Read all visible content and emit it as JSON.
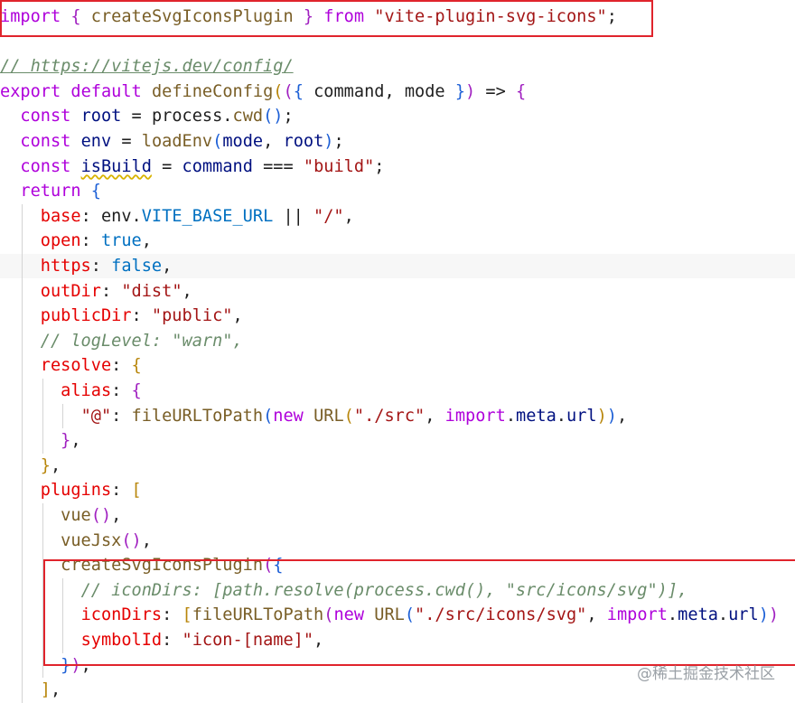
{
  "colors": {
    "background": "#ffffff",
    "keyword": "#af00db",
    "function": "#795e26",
    "variable": "#001080",
    "constant": "#0070c1",
    "string": "#a31515",
    "comment": "#6a8c6a",
    "punctuation": "#1f1f1f",
    "bracket_yellow": "#b8860b",
    "bracket_purple": "#a020c0",
    "bracket_blue": "#1c5fd6",
    "property": "#e50000",
    "annotation_box": "#e0242c"
  },
  "code": {
    "lines": [
      [
        [
          "import",
          "keyword"
        ],
        [
          " ",
          ""
        ],
        [
          "{",
          "bracket_purple"
        ],
        [
          " ",
          ""
        ],
        [
          "createSvgIconsPlugin",
          "function"
        ],
        [
          " ",
          ""
        ],
        [
          "}",
          "bracket_purple"
        ],
        [
          " ",
          ""
        ],
        [
          "from",
          "keyword"
        ],
        [
          " ",
          ""
        ],
        [
          "\"vite-plugin-svg-icons\"",
          "string"
        ],
        [
          ";",
          "punctuation"
        ]
      ],
      [],
      [
        [
          "// https://vitejs.dev/config/",
          "comment"
        ]
      ],
      [
        [
          "export",
          "keyword"
        ],
        [
          " ",
          ""
        ],
        [
          "default",
          "keyword"
        ],
        [
          " ",
          ""
        ],
        [
          "defineConfig",
          "function"
        ],
        [
          "(",
          "bracket_yellow"
        ],
        [
          "(",
          "bracket_purple"
        ],
        [
          "{",
          "bracket_blue"
        ],
        [
          " command, mode ",
          "punctuation"
        ],
        [
          "}",
          "bracket_blue"
        ],
        [
          ")",
          "bracket_purple"
        ],
        [
          " => ",
          "punctuation"
        ],
        [
          "{",
          "bracket_purple"
        ]
      ],
      [
        [
          "  ",
          ""
        ],
        [
          "const",
          "keyword"
        ],
        [
          " ",
          ""
        ],
        [
          "root",
          "variable"
        ],
        [
          " = process.",
          "punctuation"
        ],
        [
          "cwd",
          "function"
        ],
        [
          "()",
          "bracket_blue"
        ],
        [
          ";",
          "punctuation"
        ]
      ],
      [
        [
          "  ",
          ""
        ],
        [
          "const",
          "keyword"
        ],
        [
          " ",
          ""
        ],
        [
          "env",
          "variable"
        ],
        [
          " = ",
          "punctuation"
        ],
        [
          "loadEnv",
          "function"
        ],
        [
          "(",
          "bracket_blue"
        ],
        [
          "mode",
          "variable"
        ],
        [
          ", ",
          "punctuation"
        ],
        [
          "root",
          "variable"
        ],
        [
          ")",
          "bracket_blue"
        ],
        [
          ";",
          "punctuation"
        ]
      ],
      [
        [
          "  ",
          ""
        ],
        [
          "const",
          "keyword"
        ],
        [
          " ",
          ""
        ],
        [
          "isBuild",
          "variable"
        ],
        [
          " = ",
          "punctuation"
        ],
        [
          "command",
          "variable"
        ],
        [
          " === ",
          "punctuation"
        ],
        [
          "\"build\"",
          "string"
        ],
        [
          ";",
          "punctuation"
        ]
      ],
      [
        [
          "  ",
          ""
        ],
        [
          "return",
          "keyword"
        ],
        [
          " ",
          ""
        ],
        [
          "{",
          "bracket_blue"
        ]
      ],
      [
        [
          "    ",
          ""
        ],
        [
          "base",
          "property"
        ],
        [
          ": env.",
          "punctuation"
        ],
        [
          "VITE_BASE_URL",
          "constant"
        ],
        [
          " || ",
          "punctuation"
        ],
        [
          "\"/\"",
          "string"
        ],
        [
          ",",
          "punctuation"
        ]
      ],
      [
        [
          "    ",
          ""
        ],
        [
          "open",
          "property"
        ],
        [
          ": ",
          "punctuation"
        ],
        [
          "true",
          "constant"
        ],
        [
          ",",
          "punctuation"
        ]
      ],
      [
        [
          "    ",
          ""
        ],
        [
          "https",
          "property"
        ],
        [
          ": ",
          "punctuation"
        ],
        [
          "false",
          "constant"
        ],
        [
          ",",
          "punctuation"
        ]
      ],
      [
        [
          "    ",
          ""
        ],
        [
          "outDir",
          "property"
        ],
        [
          ": ",
          "punctuation"
        ],
        [
          "\"dist\"",
          "string"
        ],
        [
          ",",
          "punctuation"
        ]
      ],
      [
        [
          "    ",
          ""
        ],
        [
          "publicDir",
          "property"
        ],
        [
          ": ",
          "punctuation"
        ],
        [
          "\"public\"",
          "string"
        ],
        [
          ",",
          "punctuation"
        ]
      ],
      [
        [
          "    ",
          ""
        ],
        [
          "// logLevel: \"warn\",",
          "comment"
        ]
      ],
      [
        [
          "    ",
          ""
        ],
        [
          "resolve",
          "property"
        ],
        [
          ": ",
          "punctuation"
        ],
        [
          "{",
          "bracket_yellow"
        ]
      ],
      [
        [
          "      ",
          ""
        ],
        [
          "alias",
          "property"
        ],
        [
          ": ",
          "punctuation"
        ],
        [
          "{",
          "bracket_purple"
        ]
      ],
      [
        [
          "        ",
          ""
        ],
        [
          "\"@\"",
          "string"
        ],
        [
          ": ",
          "punctuation"
        ],
        [
          "fileURLToPath",
          "function"
        ],
        [
          "(",
          "bracket_blue"
        ],
        [
          "new",
          "keyword"
        ],
        [
          " ",
          ""
        ],
        [
          "URL",
          "function"
        ],
        [
          "(",
          "bracket_yellow"
        ],
        [
          "\"./src\"",
          "string"
        ],
        [
          ", ",
          "punctuation"
        ],
        [
          "import",
          "keyword"
        ],
        [
          ".",
          "punctuation"
        ],
        [
          "meta",
          "variable"
        ],
        [
          ".",
          "punctuation"
        ],
        [
          "url",
          "variable"
        ],
        [
          ")",
          "bracket_yellow"
        ],
        [
          ")",
          "bracket_blue"
        ],
        [
          ",",
          "punctuation"
        ]
      ],
      [
        [
          "      ",
          ""
        ],
        [
          "}",
          "bracket_purple"
        ],
        [
          ",",
          "punctuation"
        ]
      ],
      [
        [
          "    ",
          ""
        ],
        [
          "}",
          "bracket_yellow"
        ],
        [
          ",",
          "punctuation"
        ]
      ],
      [
        [
          "    ",
          ""
        ],
        [
          "plugins",
          "property"
        ],
        [
          ": ",
          "punctuation"
        ],
        [
          "[",
          "bracket_yellow"
        ]
      ],
      [
        [
          "      ",
          ""
        ],
        [
          "vue",
          "function"
        ],
        [
          "()",
          "bracket_purple"
        ],
        [
          ",",
          "punctuation"
        ]
      ],
      [
        [
          "      ",
          ""
        ],
        [
          "vueJsx",
          "function"
        ],
        [
          "()",
          "bracket_purple"
        ],
        [
          ",",
          "punctuation"
        ]
      ],
      [
        [
          "      ",
          ""
        ],
        [
          "createSvgIconsPlugin",
          "function"
        ],
        [
          "(",
          "bracket_purple"
        ],
        [
          "{",
          "bracket_blue"
        ]
      ],
      [
        [
          "        ",
          ""
        ],
        [
          "// iconDirs: [path.resolve(process.cwd(), \"src/icons/svg\")],",
          "comment"
        ]
      ],
      [
        [
          "        ",
          ""
        ],
        [
          "iconDirs",
          "property"
        ],
        [
          ": ",
          "punctuation"
        ],
        [
          "[",
          "bracket_yellow"
        ],
        [
          "fileURLToPath",
          "function"
        ],
        [
          "(",
          "bracket_purple"
        ],
        [
          "new",
          "keyword"
        ],
        [
          " ",
          ""
        ],
        [
          "URL",
          "function"
        ],
        [
          "(",
          "bracket_blue"
        ],
        [
          "\"./src/icons/svg\"",
          "string"
        ],
        [
          ", ",
          "punctuation"
        ],
        [
          "import",
          "keyword"
        ],
        [
          ".",
          "punctuation"
        ],
        [
          "meta",
          "variable"
        ],
        [
          ".",
          "punctuation"
        ],
        [
          "url",
          "variable"
        ],
        [
          ")",
          "bracket_blue"
        ],
        [
          ")",
          "bracket_purple"
        ]
      ],
      [
        [
          "        ",
          ""
        ],
        [
          "symbolId",
          "property"
        ],
        [
          ": ",
          "punctuation"
        ],
        [
          "\"icon-[name]\"",
          "string"
        ],
        [
          ",",
          "punctuation"
        ]
      ],
      [
        [
          "      ",
          ""
        ],
        [
          "}",
          "bracket_blue"
        ],
        [
          ")",
          "bracket_purple"
        ],
        [
          ",",
          "punctuation"
        ]
      ],
      [
        [
          "    ",
          ""
        ],
        [
          "]",
          "bracket_yellow"
        ],
        [
          ",",
          "punctuation"
        ]
      ]
    ]
  },
  "watermark": "@稀土掘金技术社区"
}
